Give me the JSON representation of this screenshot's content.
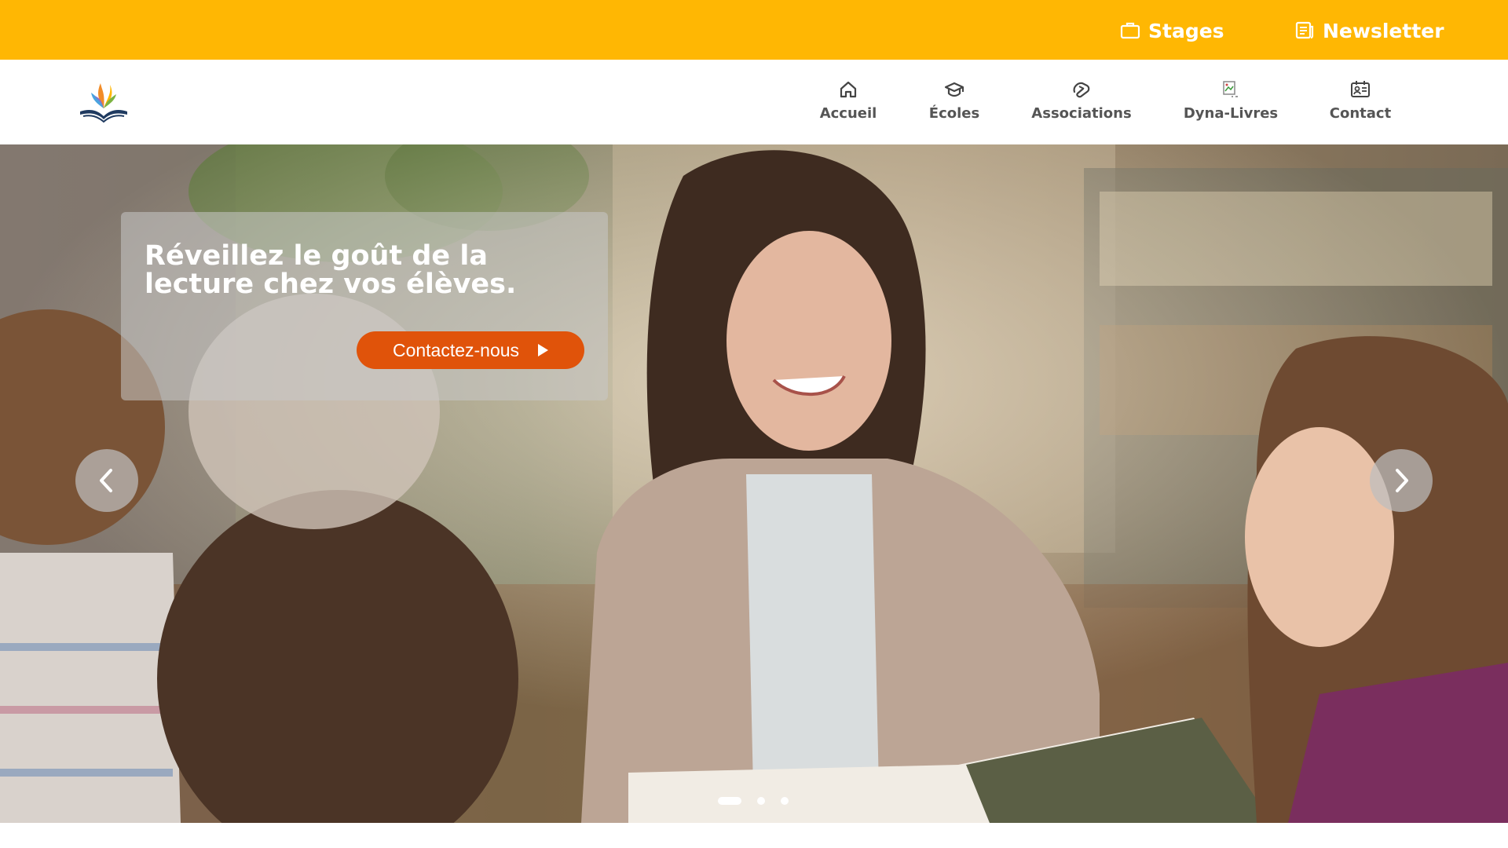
{
  "topbar": {
    "color": "#FFB703",
    "links": [
      {
        "label": "Stages",
        "icon": "briefcase-icon"
      },
      {
        "label": "Newsletter",
        "icon": "newspaper-icon"
      }
    ]
  },
  "header": {
    "logo": "book-flame-logo",
    "nav": [
      {
        "label": "Accueil",
        "icon": "home-icon"
      },
      {
        "label": "Écoles",
        "icon": "graduation-cap-icon"
      },
      {
        "label": "Associations",
        "icon": "handshake-icon"
      },
      {
        "label": "Dyna-Livres",
        "icon": "broken-image-icon"
      },
      {
        "label": "Contact",
        "icon": "contact-card-icon"
      }
    ]
  },
  "hero": {
    "title": "Réveillez le goût de la lecture chez vos élèves.",
    "cta_label": "Contactez-nous",
    "cta_color": "#E0530A",
    "background": "photo-teacher-reading-to-children",
    "slides": {
      "count": 3,
      "active": 1
    }
  }
}
